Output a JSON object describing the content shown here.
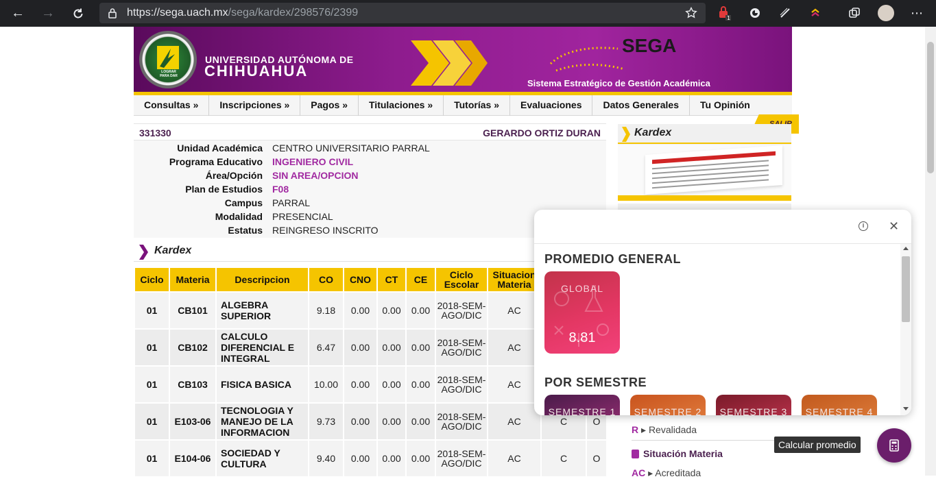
{
  "browser": {
    "url_host": "https://sega.uach.mx",
    "url_path": "/sega/kardex/298576/2399",
    "extension_badge": "1"
  },
  "banner": {
    "university_line1": "UNIVERSIDAD AUTÓNOMA DE",
    "university_line2": "CHIHUAHUA",
    "system_name": "SEGA",
    "system_subtitle": "Sistema Estratégico de Gestión Académica",
    "seal_text": "LOGRAR PARA DAR",
    "colors": {
      "brand_purple": "#8e1c8e",
      "accent_yellow": "#f5c400"
    }
  },
  "menu": [
    "Consultas »",
    "Inscripciones »",
    "Pagos »",
    "Titulaciones »",
    "Tutorías »",
    "Evaluaciones",
    "Datos Generales",
    "Tu Opinión"
  ],
  "student": {
    "id": "331330",
    "name": "GERARDO ORTIZ DURAN",
    "fields": [
      {
        "label": "Unidad Académica",
        "value": "CENTRO UNIVERSITARIO PARRAL",
        "highlight": false
      },
      {
        "label": "Programa Educativo",
        "value": "INGENIERO CIVIL",
        "highlight": true
      },
      {
        "label": "Área/Opción",
        "value": "SIN AREA/OPCION",
        "highlight": true
      },
      {
        "label": "Plan de Estudios",
        "value": "F08",
        "highlight": true
      },
      {
        "label": "Campus",
        "value": "PARRAL",
        "highlight": false
      },
      {
        "label": "Modalidad",
        "value": "PRESENCIAL",
        "highlight": false
      },
      {
        "label": "Estatus",
        "value": "REINGRESO INSCRITO",
        "highlight": false
      }
    ]
  },
  "kardex": {
    "title": "Kardex",
    "headers": [
      "Ciclo",
      "Materia",
      "Descripcion",
      "CO",
      "CNO",
      "CT",
      "CE",
      "Ciclo Escolar",
      "Situacion Materia",
      "",
      ""
    ],
    "rows": [
      {
        "ciclo": "01",
        "materia": "CB101",
        "desc": "ALGEBRA SUPERIOR",
        "co": "9.18",
        "cno": "0.00",
        "ct": "0.00",
        "ce": "0.00",
        "ciclo_escolar": "2018-SEM-AGO/DIC",
        "situacion": "AC",
        "c9": "",
        "c10": ""
      },
      {
        "ciclo": "01",
        "materia": "CB102",
        "desc": "CALCULO DIFERENCIAL E INTEGRAL",
        "co": "6.47",
        "cno": "0.00",
        "ct": "0.00",
        "ce": "0.00",
        "ciclo_escolar": "2018-SEM-AGO/DIC",
        "situacion": "AC",
        "c9": "",
        "c10": ""
      },
      {
        "ciclo": "01",
        "materia": "CB103",
        "desc": "FISICA BASICA",
        "co": "10.00",
        "cno": "0.00",
        "ct": "0.00",
        "ce": "0.00",
        "ciclo_escolar": "2018-SEM-AGO/DIC",
        "situacion": "AC",
        "c9": "",
        "c10": ""
      },
      {
        "ciclo": "01",
        "materia": "E103-06",
        "desc": "TECNOLOGIA Y MANEJO DE LA INFORMACION",
        "co": "9.73",
        "cno": "0.00",
        "ct": "0.00",
        "ce": "0.00",
        "ciclo_escolar": "2018-SEM-AGO/DIC",
        "situacion": "AC",
        "c9": "C",
        "c10": "O"
      },
      {
        "ciclo": "01",
        "materia": "E104-06",
        "desc": "SOCIEDAD Y CULTURA",
        "co": "9.40",
        "cno": "0.00",
        "ct": "0.00",
        "ce": "0.00",
        "ciclo_escolar": "2018-SEM-AGO/DIC",
        "situacion": "AC",
        "c9": "C",
        "c10": "O"
      }
    ]
  },
  "right_panel": {
    "title": "Kardex",
    "logout_label": "SALIR",
    "legend_r_code": "R",
    "legend_r_label": "Revalidada",
    "legend_section_title": "Situación Materia",
    "legend_ac_code": "AC",
    "legend_ac_label": "Acreditada"
  },
  "popup": {
    "general_title": "PROMEDIO GENERAL",
    "global_label": "GLOBAL",
    "global_value": "8.81",
    "semester_title": "POR SEMESTRE",
    "semesters": [
      "SEMESTRE 1",
      "SEMESTRE 2",
      "SEMESTRE 3",
      "SEMESTRE 4"
    ]
  },
  "fab": {
    "tooltip": "Calcular promedio"
  }
}
